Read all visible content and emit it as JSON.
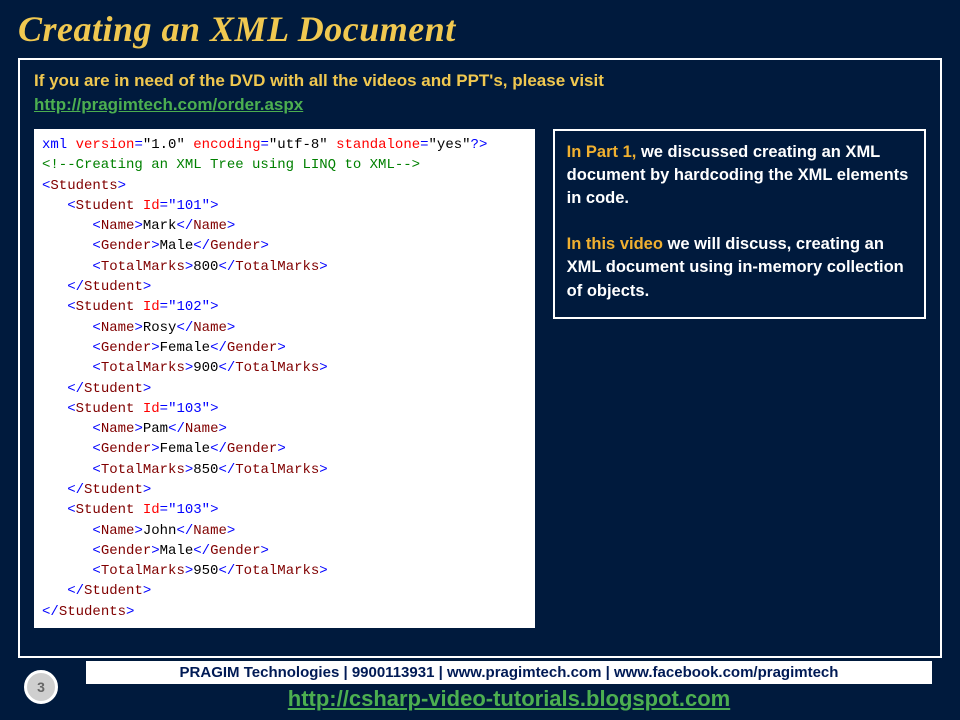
{
  "title": "Creating an XML Document",
  "dvd": {
    "text": "If you are in need of the DVD with all the videos and PPT's, please visit",
    "link": "http://pragimtech.com/order.aspx"
  },
  "xml": {
    "declaration": {
      "open": "<?",
      "name": "xml",
      "v_attr": "version",
      "v_val": "\"1.0\"",
      "e_attr": "encoding",
      "e_val": "\"utf-8\"",
      "s_attr": "standalone",
      "s_val": "\"yes\"",
      "close": "?>"
    },
    "comment": "<!--Creating an XML Tree using LINQ to XML-->",
    "root": "Students",
    "student_tag": "Student",
    "id_attr": "Id",
    "name_tag": "Name",
    "gender_tag": "Gender",
    "marks_tag": "TotalMarks",
    "students": [
      {
        "id": "\"101\"",
        "name": "Mark",
        "gender": "Male",
        "marks": "800"
      },
      {
        "id": "\"102\"",
        "name": "Rosy",
        "gender": "Female",
        "marks": "900"
      },
      {
        "id": "\"103\"",
        "name": "Pam",
        "gender": "Female",
        "marks": "850"
      },
      {
        "id": "\"103\"",
        "name": "John",
        "gender": "Male",
        "marks": "950"
      }
    ]
  },
  "info": {
    "p1_lead": "In Part 1,",
    "p1_rest": " we discussed creating an XML document by hardcoding the XML elements in code.",
    "p2_lead": "In this video",
    "p2_rest": " we will discuss, creating an XML document using in-memory collection of objects."
  },
  "footer": {
    "page": "3",
    "bar": "PRAGIM Technologies | 9900113931 | www.pragimtech.com | www.facebook.com/pragimtech",
    "link": "http://csharp-video-tutorials.blogspot.com"
  }
}
